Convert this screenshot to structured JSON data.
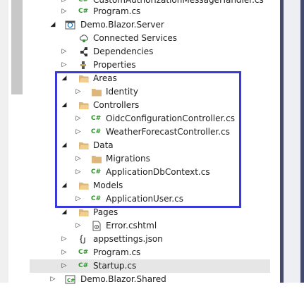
{
  "tree": {
    "items": [
      {
        "label": "CustomAuthorizationMessageHandler.cs",
        "icon": "csharp-file-icon",
        "arrow": "collapsed"
      },
      {
        "label": "Program.cs",
        "icon": "csharp-file-icon",
        "arrow": "collapsed"
      },
      {
        "label": "Demo.Blazor.Server",
        "icon": "web-project-icon",
        "arrow": "expanded"
      },
      {
        "label": "Connected Services",
        "icon": "connected-services-icon",
        "arrow": "none"
      },
      {
        "label": "Dependencies",
        "icon": "dependencies-icon",
        "arrow": "collapsed"
      },
      {
        "label": "Properties",
        "icon": "properties-icon",
        "arrow": "collapsed"
      },
      {
        "label": "Areas",
        "icon": "folder-icon",
        "arrow": "expanded"
      },
      {
        "label": "Identity",
        "icon": "folder-icon",
        "arrow": "collapsed"
      },
      {
        "label": "Controllers",
        "icon": "folder-icon",
        "arrow": "expanded"
      },
      {
        "label": "OidcConfigurationController.cs",
        "icon": "csharp-file-icon",
        "arrow": "collapsed"
      },
      {
        "label": "WeatherForecastController.cs",
        "icon": "csharp-file-icon",
        "arrow": "collapsed"
      },
      {
        "label": "Data",
        "icon": "folder-icon",
        "arrow": "expanded"
      },
      {
        "label": "Migrations",
        "icon": "folder-icon",
        "arrow": "collapsed"
      },
      {
        "label": "ApplicationDbContext.cs",
        "icon": "csharp-file-icon",
        "arrow": "collapsed"
      },
      {
        "label": "Models",
        "icon": "folder-icon",
        "arrow": "expanded"
      },
      {
        "label": "ApplicationUser.cs",
        "icon": "csharp-file-icon",
        "arrow": "collapsed"
      },
      {
        "label": "Pages",
        "icon": "folder-icon",
        "arrow": "expanded"
      },
      {
        "label": "Error.cshtml",
        "icon": "razor-page-icon",
        "arrow": "collapsed"
      },
      {
        "label": "appsettings.json",
        "icon": "json-file-icon",
        "arrow": "collapsed"
      },
      {
        "label": "Program.cs",
        "icon": "csharp-file-icon",
        "arrow": "collapsed"
      },
      {
        "label": "Startup.cs",
        "icon": "csharp-file-icon",
        "arrow": "collapsed",
        "selected": true
      },
      {
        "label": "Demo.Blazor.Shared",
        "icon": "library-project-icon",
        "arrow": "collapsed"
      }
    ],
    "csharp_glyph": "C#",
    "highlight_color": "#3a3ad8"
  }
}
